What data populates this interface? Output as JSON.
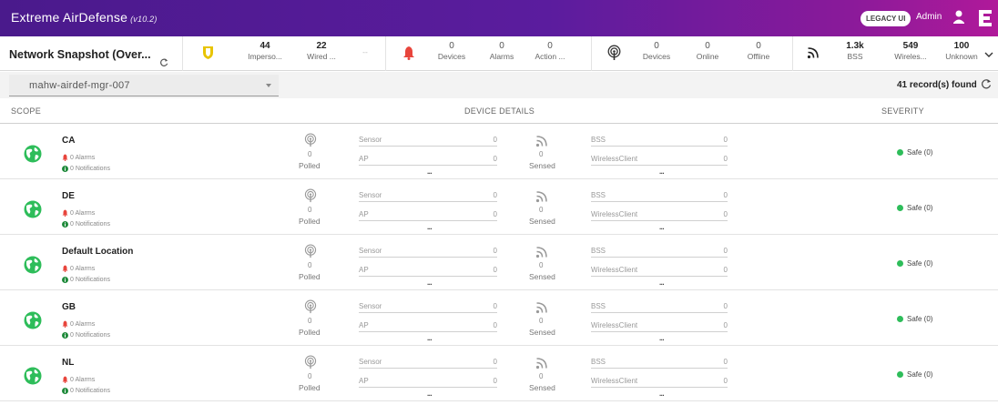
{
  "app": {
    "title": "Extreme AirDefense",
    "version": "(v10.2)",
    "legacy_label": "LEGACY UI",
    "user_label": "Admin"
  },
  "snapshot": {
    "title": "Network Snapshot (Over...",
    "stats": {
      "impersonation": {
        "num": "44",
        "label": "Imperso..."
      },
      "wired": {
        "num": "22",
        "label": "Wired ..."
      },
      "placeholder": {
        "num": "--"
      },
      "alarm_devices": {
        "num": "0",
        "label": "Devices"
      },
      "alarm_alarms": {
        "num": "0",
        "label": "Alarms"
      },
      "alarm_actions": {
        "num": "0",
        "label": "Action ..."
      },
      "sensor_devices": {
        "num": "0",
        "label": "Devices"
      },
      "sensor_online": {
        "num": "0",
        "label": "Online"
      },
      "sensor_offline": {
        "num": "0",
        "label": "Offline"
      },
      "wireless_bss": {
        "num": "1.3k",
        "label": "BSS"
      },
      "wireless_clients": {
        "num": "549",
        "label": "Wireles..."
      },
      "wireless_unknown": {
        "num": "100",
        "label": "Unknown"
      }
    }
  },
  "filter": {
    "selected": "mahw-airdef-mgr-007",
    "records": "41 record(s) found"
  },
  "table": {
    "headers": {
      "scope": "SCOPE",
      "details": "DEVICE DETAILS",
      "severity": "SEVERITY"
    },
    "rows": [
      {
        "name": "CA",
        "alarms": "0 Alarms",
        "notifications": "0 Notifications",
        "polled_num": "0",
        "polled_label": "Polled",
        "sensor_label": "Sensor",
        "sensor_val": "0",
        "ap_label": "AP",
        "ap_val": "0",
        "sensed_num": "0",
        "sensed_label": "Sensed",
        "bss_label": "BSS",
        "bss_val": "0",
        "client_label": "WirelessClient",
        "client_val": "0",
        "severity": "Safe (0)"
      },
      {
        "name": "DE",
        "alarms": "0 Alarms",
        "notifications": "0 Notifications",
        "polled_num": "0",
        "polled_label": "Polled",
        "sensor_label": "Sensor",
        "sensor_val": "0",
        "ap_label": "AP",
        "ap_val": "0",
        "sensed_num": "0",
        "sensed_label": "Sensed",
        "bss_label": "BSS",
        "bss_val": "0",
        "client_label": "WirelessClient",
        "client_val": "0",
        "severity": "Safe (0)"
      },
      {
        "name": "Default Location",
        "alarms": "0 Alarms",
        "notifications": "0 Notifications",
        "polled_num": "0",
        "polled_label": "Polled",
        "sensor_label": "Sensor",
        "sensor_val": "0",
        "ap_label": "AP",
        "ap_val": "0",
        "sensed_num": "0",
        "sensed_label": "Sensed",
        "bss_label": "BSS",
        "bss_val": "0",
        "client_label": "WirelessClient",
        "client_val": "0",
        "severity": "Safe (0)"
      },
      {
        "name": "GB",
        "alarms": "0 Alarms",
        "notifications": "0 Notifications",
        "polled_num": "0",
        "polled_label": "Polled",
        "sensor_label": "Sensor",
        "sensor_val": "0",
        "ap_label": "AP",
        "ap_val": "0",
        "sensed_num": "0",
        "sensed_label": "Sensed",
        "bss_label": "BSS",
        "bss_val": "0",
        "client_label": "WirelessClient",
        "client_val": "0",
        "severity": "Safe (0)"
      },
      {
        "name": "NL",
        "alarms": "0 Alarms",
        "notifications": "0 Notifications",
        "polled_num": "0",
        "polled_label": "Polled",
        "sensor_label": "Sensor",
        "sensor_val": "0",
        "ap_label": "AP",
        "ap_val": "0",
        "sensed_num": "0",
        "sensed_label": "Sensed",
        "bss_label": "BSS",
        "bss_val": "0",
        "client_label": "WirelessClient",
        "client_val": "0",
        "severity": "Safe (0)"
      }
    ]
  },
  "colors": {
    "header_gradient_start": "#4a1a8c",
    "header_gradient_end": "#b0199a",
    "alarm_red": "#e8453c",
    "impersonation_yellow": "#e8c400",
    "globe_green": "#2ebd5a",
    "safe_green": "#2ebd5a"
  },
  "icons": [
    "shield-icon",
    "bell-icon",
    "sensor-icon",
    "wireless-icon",
    "user-icon",
    "brand-icon",
    "refresh-icon",
    "chevron-down-icon",
    "globe-icon"
  ]
}
